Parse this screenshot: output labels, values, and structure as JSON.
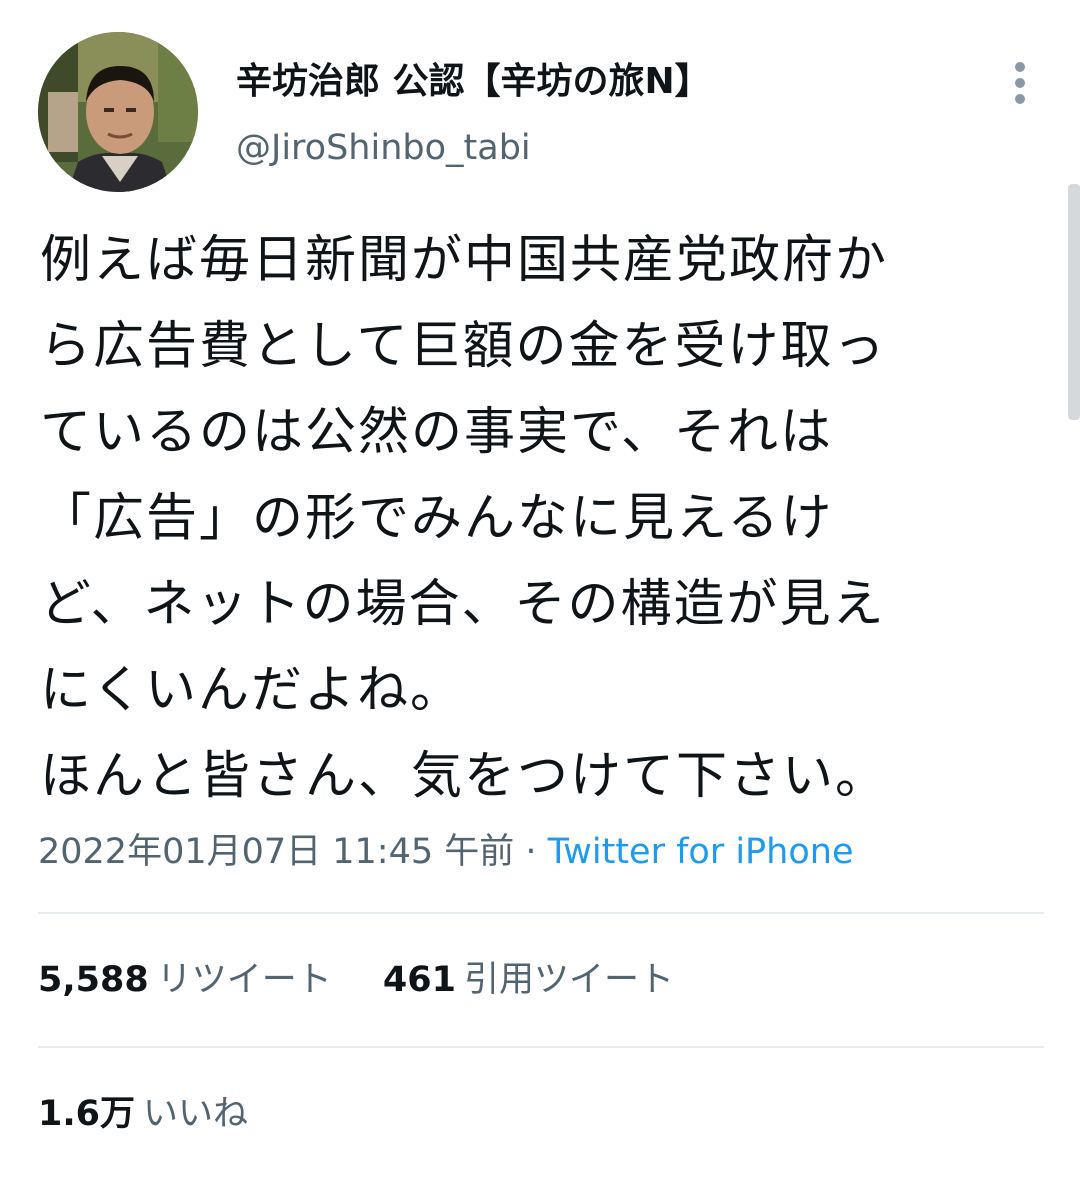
{
  "author": {
    "display_name": "辛坊治郎 公認【辛坊の旅N】",
    "handle": "@JiroShinbo_tabi"
  },
  "tweet": {
    "lines": [
      "例えば毎日新聞が中国共産党政府か",
      "ら広告費として巨額の金を受け取っ",
      "ているのは公然の事実で、それは",
      "「広告」の形でみんなに見えるけ",
      "ど、ネットの場合、その構造が見え",
      "にくいんだよね。",
      "ほんと皆さん、気をつけて下さい。"
    ],
    "timestamp": "2022年01月07日 11:45 午前",
    "separator": " · ",
    "source": "Twitter for iPhone"
  },
  "stats": {
    "retweets": {
      "count": "5,588",
      "label": "リツイート"
    },
    "quotes": {
      "count": "461",
      "label": "引用ツイート"
    },
    "likes": {
      "count": "1.6万",
      "label": "いいね"
    }
  },
  "colors": {
    "text": "#0f1419",
    "secondary": "#536471",
    "link": "#1d9bf0",
    "divider": "#e6ecf0"
  },
  "icons": {
    "more": "more-vertical-icon"
  }
}
